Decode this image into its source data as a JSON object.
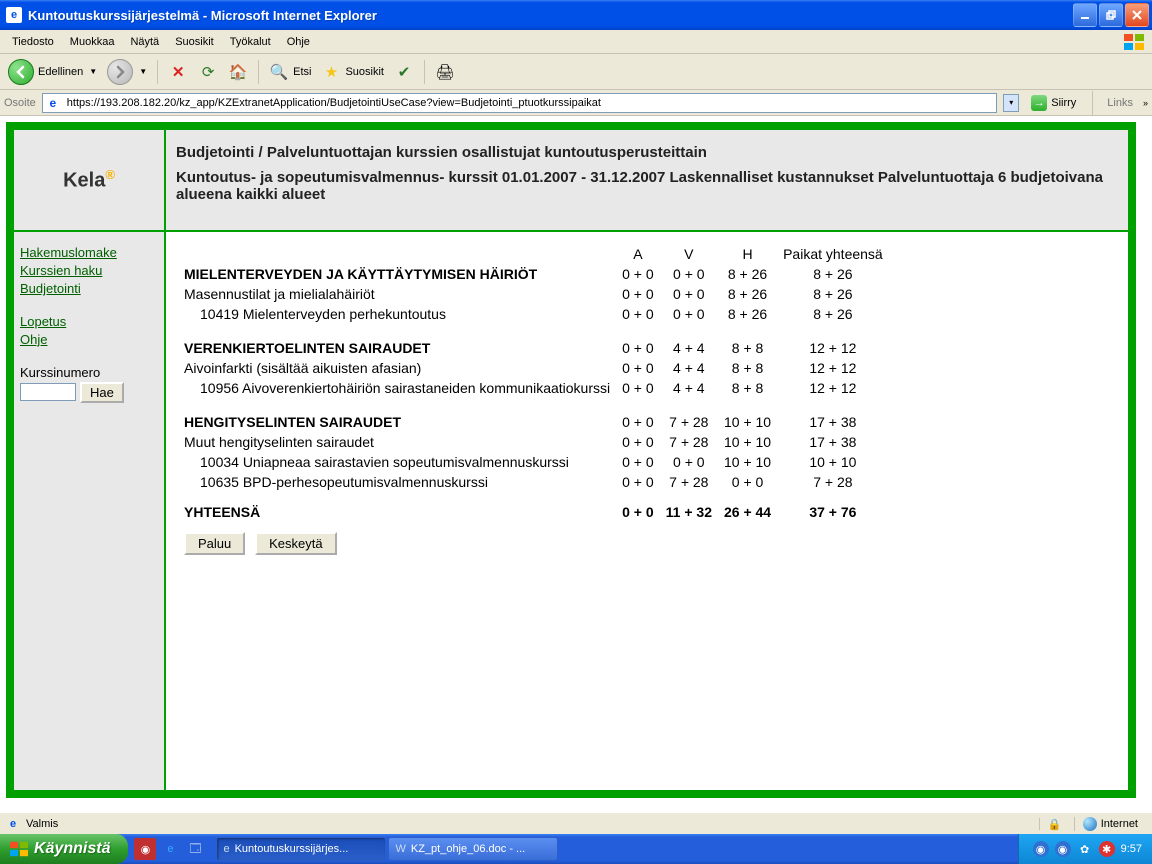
{
  "window": {
    "title": "Kuntoutuskurssijärjestelmä - Microsoft Internet Explorer"
  },
  "menu": {
    "tiedosto": "Tiedosto",
    "muokkaa": "Muokkaa",
    "nayta": "Näytä",
    "suosikit": "Suosikit",
    "tyokalut": "Työkalut",
    "ohje": "Ohje"
  },
  "toolbar": {
    "back": "Edellinen",
    "etsi": "Etsi",
    "suosikit": "Suosikit"
  },
  "address": {
    "label": "Osoite",
    "url": "https://193.208.182.20/kz_app/KZExtranetApplication/BudjetointiUseCase?view=Budjetointi_ptuotkurssipaikat",
    "go": "Siirry",
    "links": "Links"
  },
  "page": {
    "logo": "Kela",
    "title_line1": "Budjetointi / Palveluntuottajan kurssien osallistujat kuntoutusperusteittain",
    "title_line2": "Kuntoutus- ja sopeutumisvalmennus- kurssit 01.01.2007 - 31.12.2007 Laskennalliset kustannukset Palveluntuottaja 6 budjetoivana alueena kaikki alueet",
    "nav": {
      "hakemuslomake": "Hakemuslomake",
      "kurssien_haku": "Kurssien haku",
      "budjetointi": "Budjetointi",
      "lopetus": "Lopetus",
      "ohje": "Ohje",
      "kurssinumero_label": "Kurssinumero",
      "hae": "Hae"
    },
    "cols": {
      "a": "A",
      "v": "V",
      "h": "H",
      "paikat": "Paikat yhteensä"
    },
    "groups": [
      {
        "title": "MIELENTERVEYDEN JA KÄYTTÄYTYMISEN HÄIRIÖT",
        "a": "0 + 0",
        "v": "0 + 0",
        "h": "8 + 26",
        "p": "8 + 26",
        "subs": [
          {
            "label": "Masennustilat ja mielialahäiriöt",
            "a": "0 + 0",
            "v": "0 + 0",
            "h": "8 + 26",
            "p": "8 + 26",
            "courses": [
              {
                "label": "10419 Mielenterveyden perhekuntoutus",
                "a": "0 + 0",
                "v": "0 + 0",
                "h": "8 + 26",
                "p": "8 + 26"
              }
            ]
          }
        ]
      },
      {
        "title": "VERENKIERTOELINTEN SAIRAUDET",
        "a": "0 + 0",
        "v": "4 + 4",
        "h": "8 + 8",
        "p": "12 + 12",
        "subs": [
          {
            "label": "Aivoinfarkti (sisältää aikuisten afasian)",
            "a": "0 + 0",
            "v": "4 + 4",
            "h": "8 + 8",
            "p": "12 + 12",
            "courses": [
              {
                "label": "10956 Aivoverenkiertohäiriön sairastaneiden kommunikaatiokurssi",
                "a": "0 + 0",
                "v": "4 + 4",
                "h": "8 + 8",
                "p": "12 + 12"
              }
            ]
          }
        ]
      },
      {
        "title": "HENGITYSELINTEN SAIRAUDET",
        "a": "0 + 0",
        "v": "7 + 28",
        "h": "10 + 10",
        "p": "17 + 38",
        "subs": [
          {
            "label": "Muut hengityselinten sairaudet",
            "a": "0 + 0",
            "v": "7 + 28",
            "h": "10 + 10",
            "p": "17 + 38",
            "courses": [
              {
                "label": "10034 Uniapneaa sairastavien sopeutumisvalmennuskurssi",
                "a": "0 + 0",
                "v": "0 + 0",
                "h": "10 + 10",
                "p": "10 + 10"
              },
              {
                "label": "10635 BPD-perhesopeutumisvalmennuskurssi",
                "a": "0 + 0",
                "v": "7 + 28",
                "h": "0 + 0",
                "p": "7 + 28"
              }
            ]
          }
        ]
      }
    ],
    "total": {
      "label": "YHTEENSÄ",
      "a": "0 + 0",
      "v": "11 + 32",
      "h": "26 + 44",
      "p": "37 + 76"
    },
    "actions": {
      "paluu": "Paluu",
      "keskeyta": "Keskeytä"
    }
  },
  "status": {
    "valmis": "Valmis",
    "internet": "Internet"
  },
  "taskbar": {
    "start": "Käynnistä",
    "task1": "Kuntoutuskurssijärjes...",
    "task2": "KZ_pt_ohje_06.doc - ...",
    "clock": "9:57"
  }
}
